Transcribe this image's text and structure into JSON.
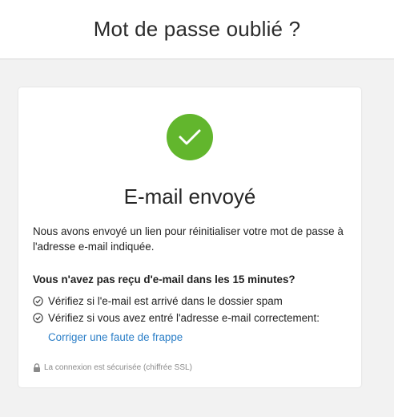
{
  "header": {
    "title": "Mot de passe oublié ?"
  },
  "card": {
    "icon": "check-circle-icon",
    "success_color": "#62b62d",
    "title": "E-mail envoyé",
    "description": "Nous avons envoyé un lien pour réinitialiser votre mot de passe à l'adresse e-mail indiquée.",
    "subheading": "Vous n'avez pas reçu d'e-mail dans les 15 minutes?",
    "tips": [
      {
        "icon": "check-outline-icon",
        "text": "Vérifiez si l'e-mail est arrivé dans le dossier spam"
      },
      {
        "icon": "check-outline-icon",
        "text": "Vérifiez si vous avez entré l'adresse e-mail correctement:"
      }
    ],
    "fix_link": "Corriger une faute de frappe",
    "link_color": "#2b7ec7",
    "secure_icon": "lock-icon",
    "secure_text": "La connexion est sécurisée (chiffrée SSL)"
  }
}
